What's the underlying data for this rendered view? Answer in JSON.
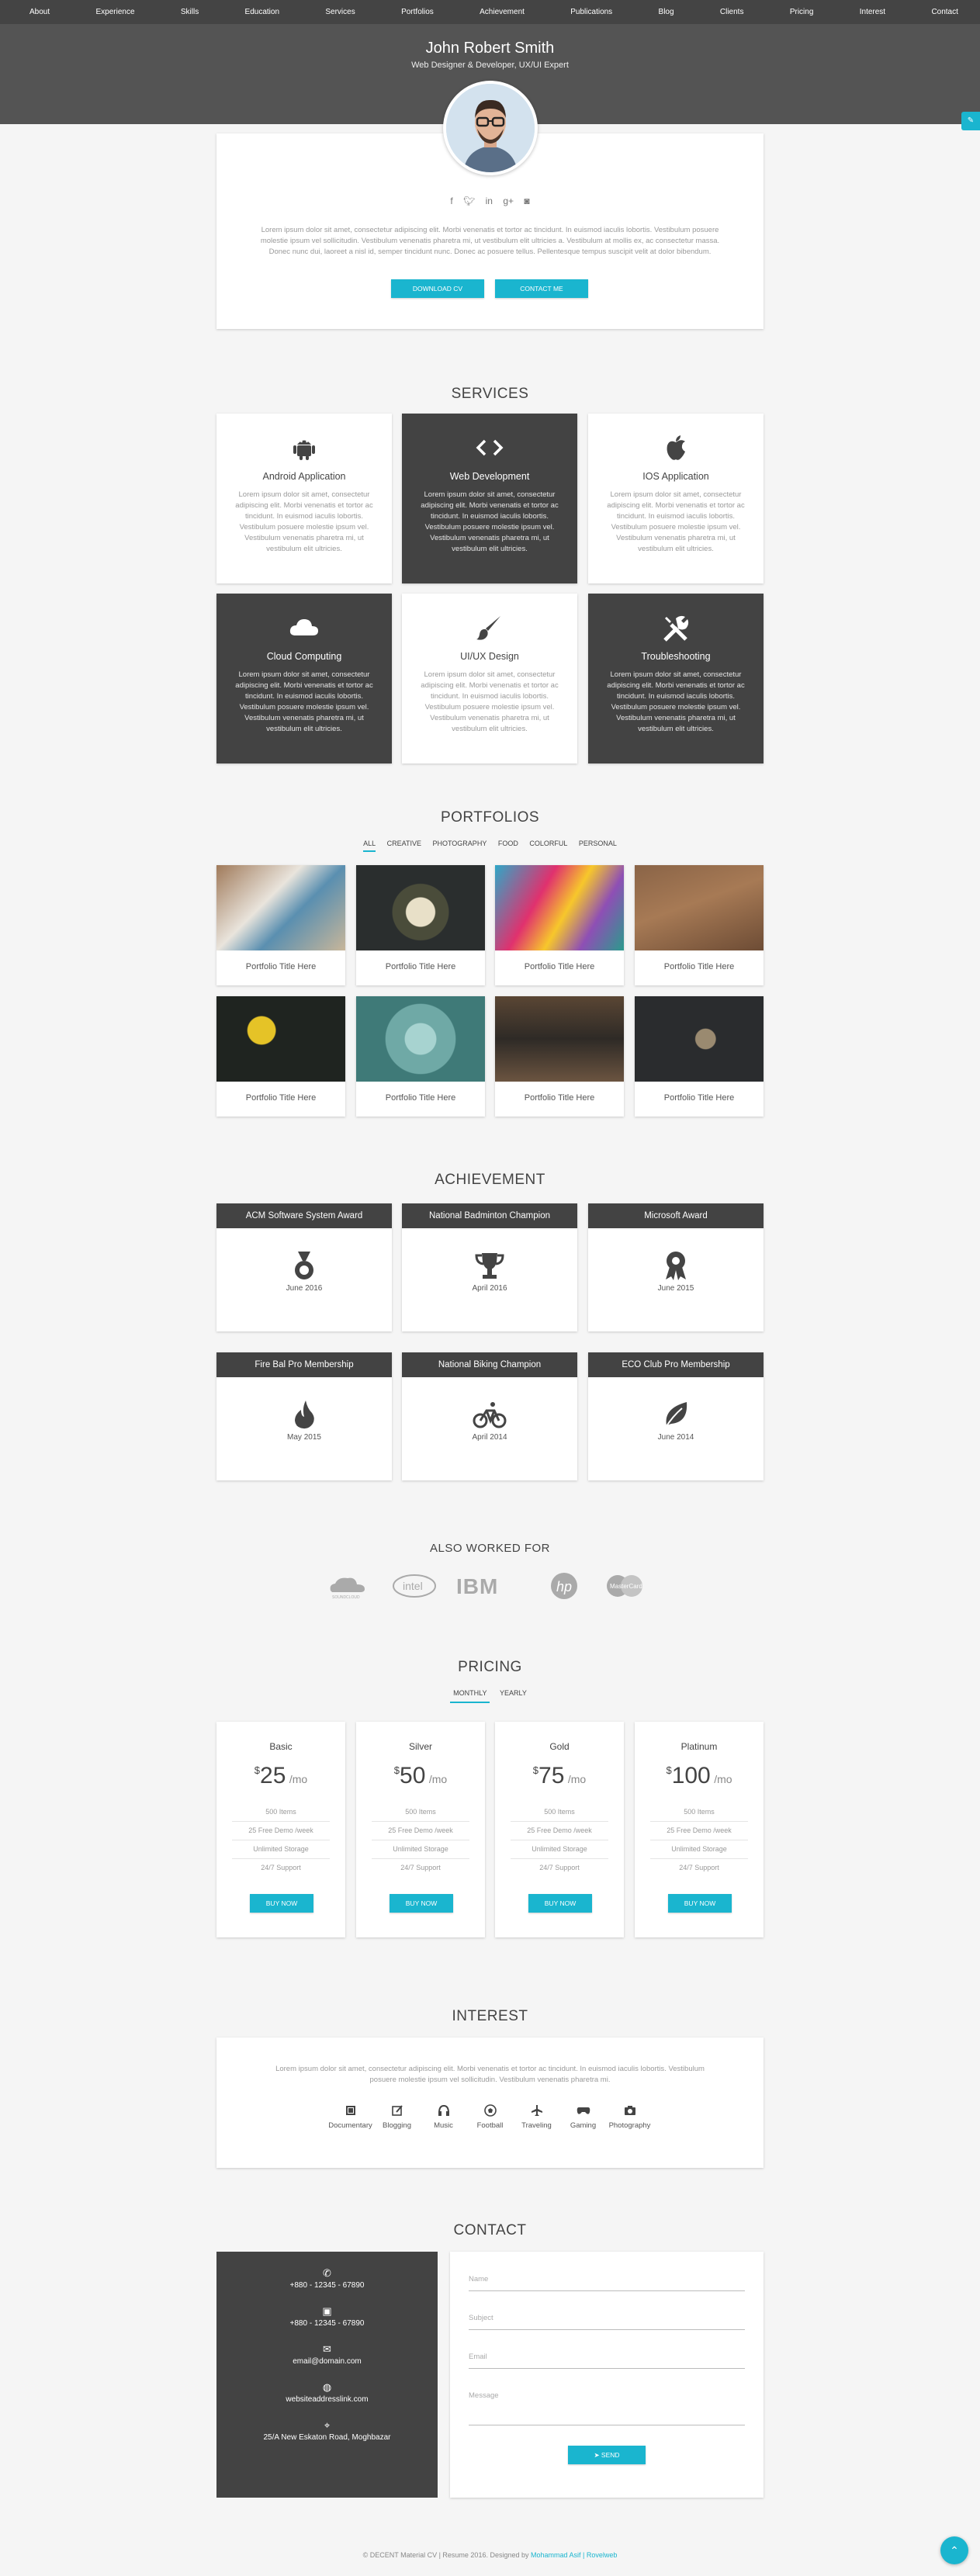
{
  "nav": [
    "About",
    "Experience",
    "Skills",
    "Education",
    "Services",
    "Portfolios",
    "Achievement",
    "Publications",
    "Blog",
    "Clients",
    "Pricing",
    "Interest",
    "Contact"
  ],
  "profile": {
    "name": "John Robert Smith",
    "title": "Web Designer & Developer, UX/UI Expert",
    "social_icons": [
      "facebook-icon",
      "twitter-icon",
      "linkedin-icon",
      "google-plus-icon",
      "instagram-icon"
    ],
    "bio": "Lorem ipsum dolor sit amet, consectetur adipiscing elit. Morbi venenatis et tortor ac tincidunt. In euismod iaculis lobortis. Vestibulum posuere molestie ipsum vel sollicitudin. Vestibulum venenatis pharetra mi, ut vestibulum elit ultricies a. Vestibulum at mollis ex, ac consectetur massa. Donec nunc dui, laoreet a nisl id, semper tincidunt nunc. Donec ac posuere tellus. Pellentesque tempus suscipit velit at dolor bibendum.",
    "download_label": "DOWNLOAD CV",
    "contact_label": "CONTACT ME"
  },
  "services": {
    "title": "SERVICES",
    "desc": "Lorem ipsum dolor sit amet, consectetur adipiscing elit. Morbi venenatis et tortor ac tincidunt. In euismod iaculis lobortis. Vestibulum posuere molestie ipsum vel. Vestibulum venenatis pharetra mi, ut vestibulum elit ultricies.",
    "items": [
      {
        "label": "Android Application",
        "icon": "android-icon"
      },
      {
        "label": "Web Development",
        "icon": "code-icon"
      },
      {
        "label": "IOS Application",
        "icon": "apple-icon"
      },
      {
        "label": "Cloud Computing",
        "icon": "cloud-icon"
      },
      {
        "label": "UI/UX Design",
        "icon": "paintbrush-icon"
      },
      {
        "label": "Troubleshooting",
        "icon": "tools-icon"
      }
    ]
  },
  "portfolios": {
    "title": "PORTFOLIOS",
    "filters": [
      "ALL",
      "CREATIVE",
      "PHOTOGRAPHY",
      "FOOD",
      "COLORFUL",
      "PERSONAL"
    ],
    "caption": "Portfolio Title Here"
  },
  "achievement": {
    "title": "ACHIEVEMENT",
    "items": [
      {
        "label": "ACM Software System Award",
        "date": "June 2016",
        "icon": "medal-icon"
      },
      {
        "label": "National Badminton Champion",
        "date": "April 2016",
        "icon": "trophy-icon"
      },
      {
        "label": "Microsoft Award",
        "date": "June 2015",
        "icon": "ribbon-icon"
      },
      {
        "label": "Fire Bal Pro Membership",
        "date": "May 2015",
        "icon": "flame-icon"
      },
      {
        "label": "National Biking Champion",
        "date": "April 2014",
        "icon": "bicycle-icon"
      },
      {
        "label": "ECO Club Pro Membership",
        "date": "June 2014",
        "icon": "leaf-icon"
      }
    ]
  },
  "worked_for": {
    "title": "ALSO WORKED FOR",
    "logos": [
      "soundcloud-logo",
      "intel-logo",
      "ibm-logo",
      "hp-logo",
      "mastercard-logo"
    ]
  },
  "pricing": {
    "title": "PRICING",
    "tabs": [
      "MONTHLY",
      "YEARLY"
    ],
    "currency": "$",
    "period": "/mo",
    "features": [
      "500 Items",
      "25 Free Demo /week",
      "Unlimited Storage",
      "24/7 Support"
    ],
    "buy_label": "BUY NOW",
    "plans": [
      {
        "name": "Basic",
        "price": "25"
      },
      {
        "name": "Silver",
        "price": "50"
      },
      {
        "name": "Gold",
        "price": "75"
      },
      {
        "name": "Platinum",
        "price": "100"
      }
    ]
  },
  "interest": {
    "title": "INTEREST",
    "text": "Lorem ipsum dolor sit amet, consectetur adipiscing elit. Morbi venenatis et tortor ac tincidunt. In euismod iaculis lobortis. Vestibulum posuere molestie ipsum vel sollicitudin. Vestibulum venenatis pharetra mi.",
    "items": [
      "Documentary",
      "Blogging",
      "Music",
      "Football",
      "Traveling",
      "Gaming",
      "Photography"
    ]
  },
  "contact": {
    "title": "CONTACT",
    "phone": "+880 - 12345 - 67890",
    "fax": "+880 - 12345 - 67890",
    "email": "email@domain.com",
    "website": "websiteaddresslink.com",
    "address": "25/A New Eskaton Road, Moghbazar",
    "form": {
      "name": "Name",
      "subject": "Subject",
      "email": "Email",
      "message": "Message",
      "send": "SEND"
    }
  },
  "footer": {
    "text": "© DECENT Material CV | Resume 2016. Designed by",
    "author": "Mohammad Asif | Rovelweb"
  },
  "colors": {
    "accent": "#1ab5cf",
    "dark": "#434343",
    "hero": "#545454"
  }
}
